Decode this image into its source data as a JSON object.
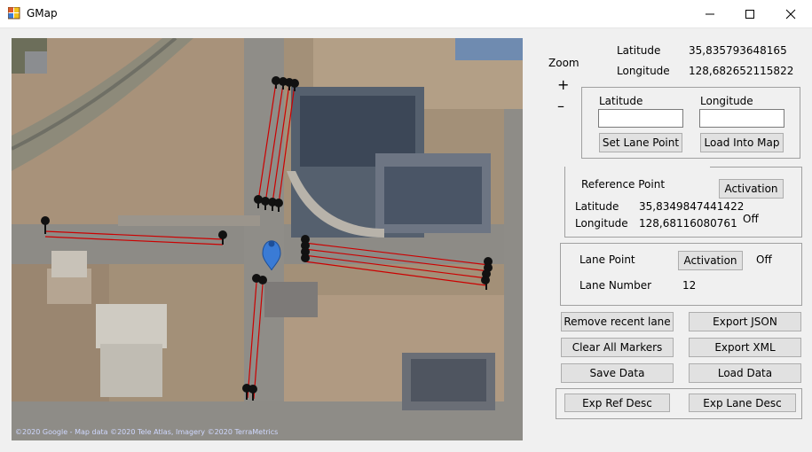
{
  "window": {
    "title": "GMap",
    "minimize_glyph": "—",
    "maximize_glyph": "☐",
    "close_glyph": "✕"
  },
  "map": {
    "attribution": "©2020 Google - Map data ©2020 Tele Atlas, Imagery ©2020 TerraMetrics",
    "lane_color": "#cc0000",
    "marker_color": "#111111",
    "center_marker_color": "#3a7bd5"
  },
  "zoom": {
    "label": "Zoom",
    "plus": "+",
    "minus": "–"
  },
  "position": {
    "latitude_label": "Latitude",
    "latitude_value": "35,835793648165",
    "longitude_label": "Longitude",
    "longitude_value": "128,682652115822"
  },
  "lane_input": {
    "latitude_label": "Latitude",
    "longitude_label": "Longitude",
    "latitude_value": "",
    "longitude_value": "",
    "set_lane_point": "Set Lane Point",
    "load_into_map": "Load Into Map"
  },
  "reference": {
    "title": "Reference Point",
    "activation": "Activation",
    "latitude_label": "Latitude",
    "latitude_value": "35,8349847441422",
    "longitude_label": "Longitude",
    "longitude_value": "128,68116080761",
    "status": "Off"
  },
  "lane": {
    "lane_point_label": "Lane Point",
    "activation": "Activation",
    "status": "Off",
    "lane_number_label": "Lane Number",
    "lane_number_value": "12"
  },
  "actions": {
    "remove_recent_lane": "Remove recent lane",
    "export_json": "Export JSON",
    "clear_all_markers": "Clear All Markers",
    "export_xml": "Export XML",
    "save_data": "Save Data",
    "load_data": "Load Data",
    "exp_ref_desc": "Exp Ref Desc",
    "exp_lane_desc": "Exp Lane Desc"
  }
}
